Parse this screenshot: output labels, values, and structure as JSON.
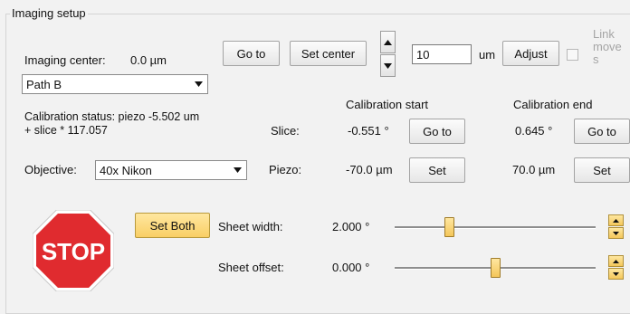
{
  "group_title": "Imaging setup",
  "imaging_center": {
    "label": "Imaging center:",
    "value": "0.0 µm",
    "goto_button": "Go to",
    "set_center_button": "Set center",
    "step_value": "10",
    "step_unit": "um",
    "adjust_button": "Adjust",
    "link_label_line1": "Link",
    "link_label_line2": "move",
    "link_label_line3": "s"
  },
  "path_select": {
    "value": "Path B"
  },
  "calibration": {
    "status_line1": "Calibration status: piezo -5.502 um",
    "status_line2": "+ slice * 117.057",
    "start_header": "Calibration start",
    "end_header": "Calibration end",
    "slice_label": "Slice:",
    "slice_start_value": "-0.551 °",
    "slice_start_button": "Go to",
    "slice_end_value": "0.645 °",
    "slice_end_button": "Go to",
    "piezo_label": "Piezo:",
    "piezo_start_value": "-70.0 µm",
    "piezo_start_button": "Set",
    "piezo_end_value": "70.0 µm",
    "piezo_end_button": "Set"
  },
  "objective": {
    "label": "Objective:",
    "value": "40x Nikon"
  },
  "stop_sign": {
    "text": "STOP",
    "color": "#e02b2f"
  },
  "set_both_button": "Set Both",
  "sheet_width": {
    "label": "Sheet width:",
    "value": "2.000 °",
    "slider_fraction": 0.26
  },
  "sheet_offset": {
    "label": "Sheet offset:",
    "value": "0.000 °",
    "slider_fraction": 0.5
  },
  "colors": {
    "accent_yellow": "#f9cf65",
    "stop_red": "#e02b2f"
  }
}
